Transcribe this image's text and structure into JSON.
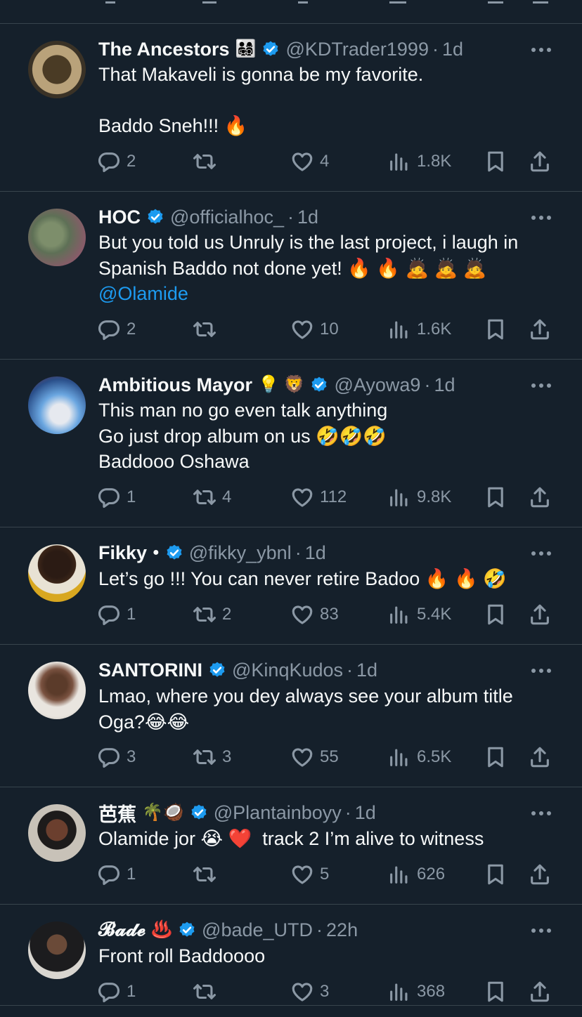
{
  "colors": {
    "background": "#15202b",
    "divider": "#38444d",
    "muted": "#8b98a5",
    "accent": "#1d9bf0",
    "text": "#f7f9f9"
  },
  "tweets": [
    {
      "name": "The Ancestors",
      "name_emoji": "👨‍👩‍👧‍👦",
      "verified": true,
      "handle": "@KDTrader1999",
      "time": "1d",
      "lines": [
        "That Makaveli is gonna be my favorite.",
        "",
        "Baddo Sneh!!! 🔥"
      ],
      "replies": "2",
      "retweets": "",
      "likes": "4",
      "views": "1.8K"
    },
    {
      "name": "HOC",
      "name_emoji": "",
      "verified": true,
      "handle": "@officialhoc_",
      "time": "1d",
      "lines": [
        "But you told us Unruly is the last project, i laugh in",
        "Spanish Baddo not done yet! 🔥 🔥 🙇 🙇 🙇"
      ],
      "mention": "@Olamide",
      "replies": "2",
      "retweets": "",
      "likes": "10",
      "views": "1.6K"
    },
    {
      "name": "Ambitious Mayor",
      "name_emoji": "💡 🦁",
      "verified": true,
      "handle": "@Ayowa9",
      "time": "1d",
      "lines": [
        "This man no go even talk anything",
        "Go just drop album on us 🤣🤣🤣",
        "Baddooo Oshawa"
      ],
      "replies": "1",
      "retweets": "4",
      "likes": "112",
      "views": "9.8K"
    },
    {
      "name": "Fikky",
      "name_emoji": "●",
      "verified": true,
      "handle": "@fikky_ybnl",
      "time": "1d",
      "lines": [
        "Let’s go !!! You can never retire Badoo 🔥 🔥 🤣"
      ],
      "replies": "1",
      "retweets": "2",
      "likes": "83",
      "views": "5.4K"
    },
    {
      "name": "SANTORINI",
      "name_emoji": "",
      "verified": true,
      "handle": "@KinqKudos",
      "time": "1d",
      "lines": [
        "Lmao, where you dey always see your album title",
        "Oga?😂😂"
      ],
      "replies": "3",
      "retweets": "3",
      "likes": "55",
      "views": "6.5K"
    },
    {
      "name": "芭蕉",
      "name_emoji": "🌴🥥",
      "verified": true,
      "handle": "@Plantainboyy",
      "time": "1d",
      "lines": [
        "Olamide jor 😭 ❤️  track 2 I’m alive to witness"
      ],
      "replies": "1",
      "retweets": "",
      "likes": "5",
      "views": "626"
    },
    {
      "name": "𝓑𝓪𝓭𝓮",
      "name_emoji": "♨️",
      "verified": true,
      "handle": "@bade_UTD",
      "time": "22h",
      "lines": [
        "Front roll Baddoooo"
      ],
      "replies": "1",
      "retweets": "",
      "likes": "3",
      "views": "368"
    }
  ]
}
